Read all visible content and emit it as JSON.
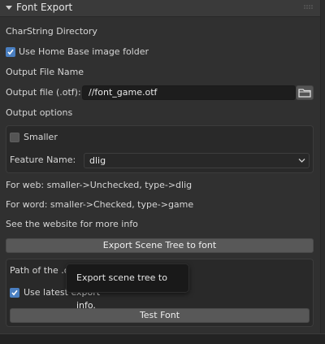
{
  "panel": {
    "title": "Font Export",
    "charstring_section": "CharString Directory",
    "use_home_base": {
      "label": "Use Home Base image folder",
      "checked": true
    },
    "output_file_section": "Output File Name",
    "output_file": {
      "label": "Output file (.otf):",
      "value": "//font_game.otf"
    },
    "output_options_section": "Output options",
    "smaller": {
      "label": "Smaller",
      "checked": false
    },
    "feature_name": {
      "label": "Feature Name:",
      "value": "dlig"
    },
    "hint_web": "For web: smaller->Unchecked, type->dlig",
    "hint_word": "For word: smaller->Checked, type->game",
    "hint_more": "See the website for more info",
    "export_button": "Export Scene Tree to font",
    "path_label": "Path of the .otf file you want to test",
    "use_latest_export": {
      "label": "Use latest export",
      "checked": true
    },
    "test_font_button": "Test Font"
  },
  "tooltip": {
    "text": "Export scene tree to info."
  },
  "icons": {
    "collapse": "chevron-down-icon",
    "drag": "drag-grip-icon",
    "folder": "folder-icon",
    "dropdown": "chevron-down-icon",
    "check": "checkmark-icon"
  },
  "colors": {
    "accent": "#4a7fc1",
    "panel_bg": "#303030",
    "field_bg": "#1d1d1d"
  }
}
